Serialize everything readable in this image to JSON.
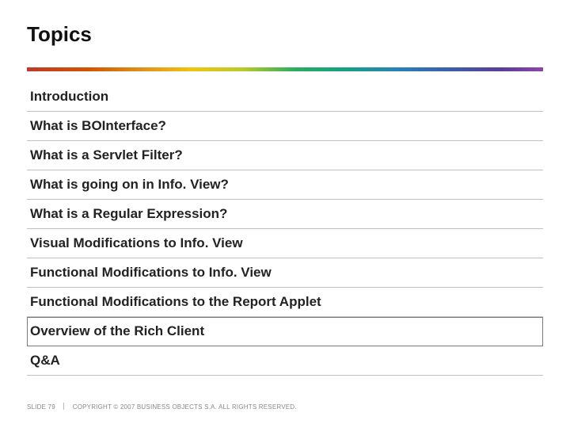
{
  "title": "Topics",
  "topics": [
    {
      "label": "Introduction"
    },
    {
      "label": "What is BOInterface?"
    },
    {
      "label": "What is a Servlet Filter?"
    },
    {
      "label": "What is going on in Info. View?"
    },
    {
      "label": "What is a Regular Expression?"
    },
    {
      "label": "Visual Modifications to Info. View"
    },
    {
      "label": "Functional Modifications to Info. View"
    },
    {
      "label": "Functional Modifications to the Report Applet"
    },
    {
      "label": "Overview of the Rich Client"
    },
    {
      "label": "Q&A"
    }
  ],
  "highlight_index": 8,
  "footer": {
    "slide": "SLIDE 79",
    "copyright": "COPYRIGHT © 2007 BUSINESS OBJECTS S.A. ALL RIGHTS RESERVED."
  }
}
